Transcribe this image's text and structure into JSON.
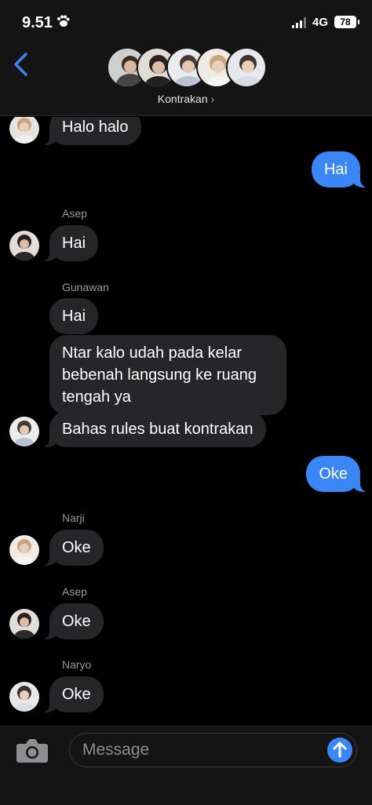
{
  "status_bar": {
    "time": "9.51",
    "network": "4G",
    "battery": "78"
  },
  "header": {
    "group_name": "Kontrakan",
    "chevron": "›"
  },
  "messages": [
    {
      "type": "received",
      "text": "Halo halo"
    },
    {
      "type": "sent",
      "text": "Hai"
    },
    {
      "type": "received",
      "sender": "Asep",
      "text": "Hai"
    },
    {
      "type": "received",
      "sender": "Gunawan",
      "text": "Hai"
    },
    {
      "type": "received",
      "text": "Ntar kalo udah pada kelar\nbebenah langsung ke ruang\ntengah ya"
    },
    {
      "type": "received",
      "text": "Bahas rules buat kontrakan"
    },
    {
      "type": "sent",
      "text": "Oke"
    },
    {
      "type": "received",
      "sender": "Narji",
      "text": "Oke"
    },
    {
      "type": "received",
      "sender": "Asep",
      "text": "Oke"
    },
    {
      "type": "received",
      "sender": "Naryo",
      "text": "Oke"
    }
  ],
  "input": {
    "placeholder": "Message"
  },
  "icons": {
    "back": "chevron-left-icon",
    "camera": "camera-icon",
    "send": "arrow-up-icon"
  },
  "colors": {
    "sent_bubble": "#3a86f5",
    "received_bubble": "#262628",
    "accent": "#3a86f5"
  }
}
